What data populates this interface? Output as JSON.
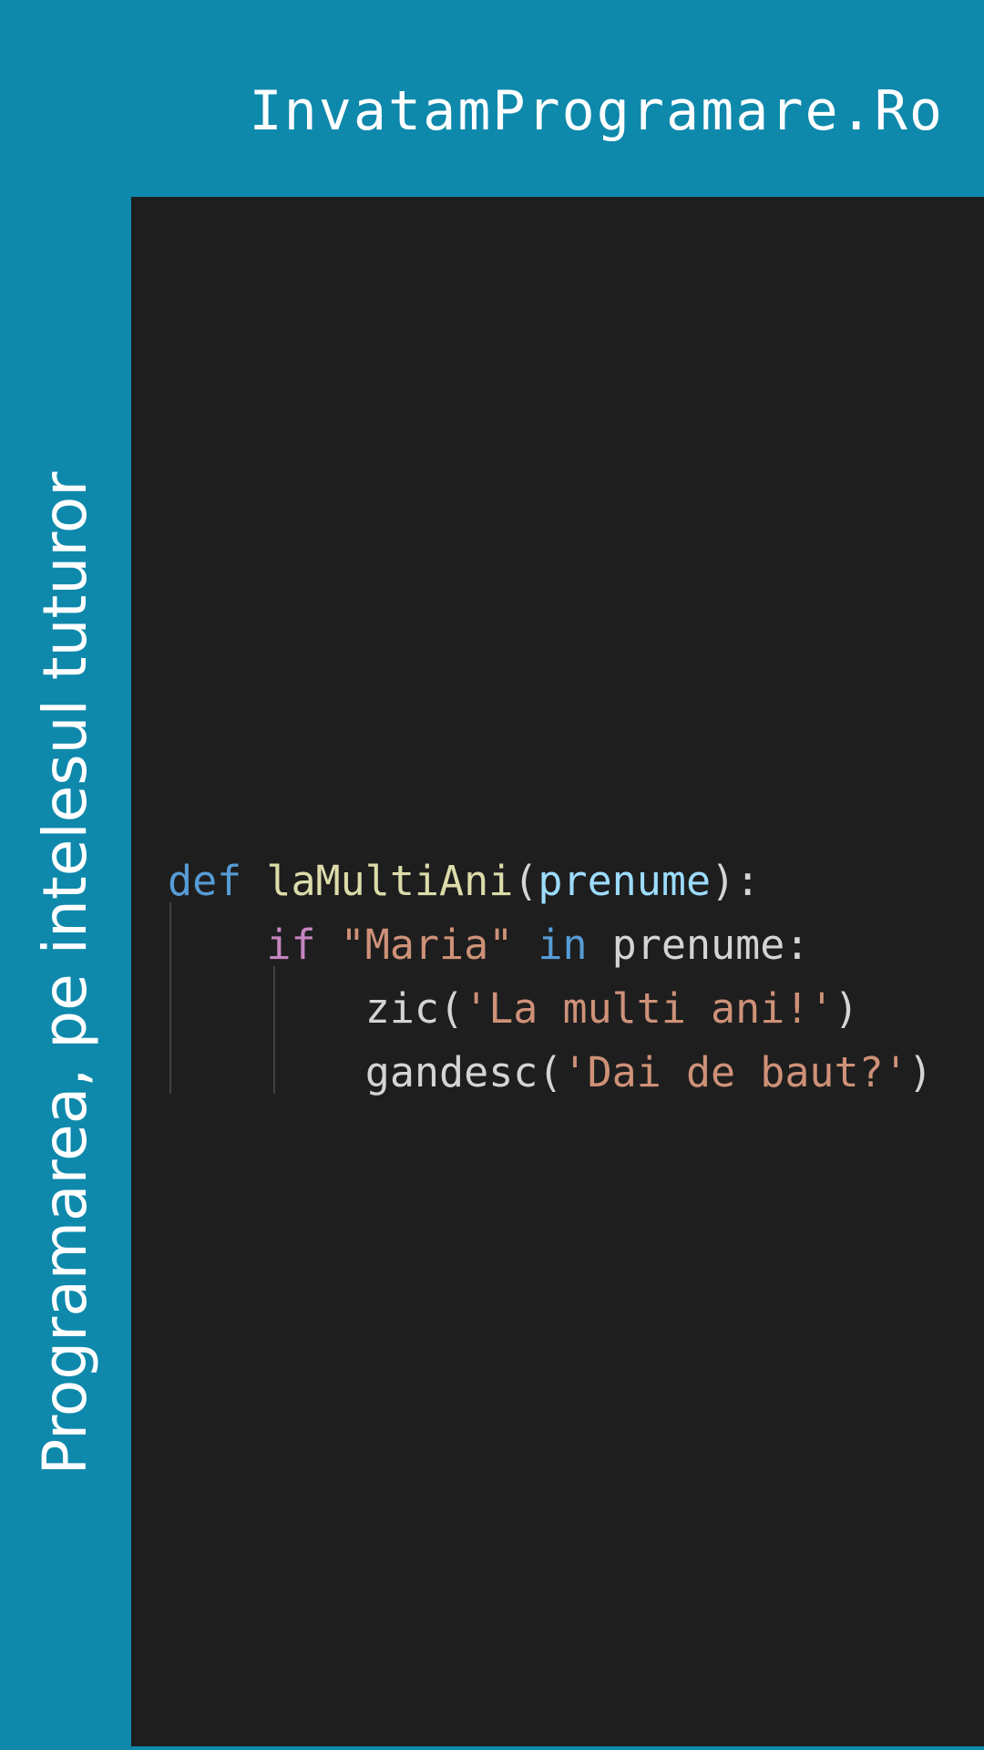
{
  "header": {
    "site_title": "InvatamProgramare.Ro"
  },
  "sidebar": {
    "tagline": "Programarea, pe intelesul tuturor"
  },
  "code": {
    "lines": [
      [
        {
          "type": "keyword",
          "text": "def"
        },
        {
          "type": "plain",
          "text": " "
        },
        {
          "type": "function",
          "text": "laMultiAni"
        },
        {
          "type": "plain",
          "text": "("
        },
        {
          "type": "param",
          "text": "prenume"
        },
        {
          "type": "plain",
          "text": "):"
        }
      ],
      [
        {
          "type": "plain",
          "text": "    "
        },
        {
          "type": "control",
          "text": "if"
        },
        {
          "type": "plain",
          "text": " "
        },
        {
          "type": "string",
          "text": "\"Maria\""
        },
        {
          "type": "plain",
          "text": " "
        },
        {
          "type": "keyword",
          "text": "in"
        },
        {
          "type": "plain",
          "text": " prenume:"
        }
      ],
      [
        {
          "type": "plain",
          "text": "        zic("
        },
        {
          "type": "string",
          "text": "'La multi ani!'"
        },
        {
          "type": "plain",
          "text": ")"
        }
      ],
      [
        {
          "type": "plain",
          "text": "        gandesc("
        },
        {
          "type": "string",
          "text": "'Dai de baut?'"
        },
        {
          "type": "plain",
          "text": ")"
        }
      ]
    ]
  },
  "colors": {
    "brand_background": "#0e89ac",
    "editor_background": "#1e1e1e",
    "keyword": "#569cd6",
    "control_keyword": "#c586c0",
    "function_name": "#dcdcaa",
    "parameter": "#9cdcfe",
    "string": "#ce9178",
    "default_text": "#d4d4d4"
  }
}
